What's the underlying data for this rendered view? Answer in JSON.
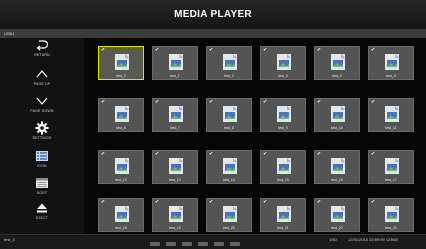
{
  "window": {
    "title": "MEDIA PLAYER"
  },
  "path": {
    "text": "USB1"
  },
  "sidebar": {
    "items": [
      {
        "label": "RETURN",
        "icon": "return-icon"
      },
      {
        "label": "PAGE UP",
        "icon": "chevron-up-icon"
      },
      {
        "label": "PAGE DOWN",
        "icon": "chevron-down-icon"
      },
      {
        "label": "SETTINGS",
        "icon": "gear-icon"
      },
      {
        "label": "ICON",
        "icon": "icon-view-icon"
      },
      {
        "label": "SORT",
        "icon": "sort-icon"
      },
      {
        "label": "EJECT",
        "icon": "eject-icon"
      }
    ]
  },
  "files": [
    {
      "name": "test_0",
      "selected": true
    },
    {
      "name": "test_1"
    },
    {
      "name": "test_2"
    },
    {
      "name": "test_3"
    },
    {
      "name": "test_4"
    },
    {
      "name": "test_5"
    },
    {
      "name": "test_6"
    },
    {
      "name": "test_7"
    },
    {
      "name": "test_8"
    },
    {
      "name": "test_9"
    },
    {
      "name": "test_10"
    },
    {
      "name": "test_11"
    },
    {
      "name": "test_12"
    },
    {
      "name": "test_13"
    },
    {
      "name": "test_14"
    },
    {
      "name": "test_15"
    },
    {
      "name": "test_16"
    },
    {
      "name": "test_17"
    },
    {
      "name": "test_18"
    },
    {
      "name": "test_19"
    },
    {
      "name": "test_20"
    },
    {
      "name": "test_21"
    },
    {
      "name": "test_22"
    },
    {
      "name": "test_23"
    }
  ],
  "status": {
    "filename": "test_0",
    "page": "1/50",
    "datetime": "12/31/2015 23:59:59 123KB"
  },
  "colors": {
    "selection": "#e8e000",
    "tile": "#545454",
    "background": "#000000"
  }
}
